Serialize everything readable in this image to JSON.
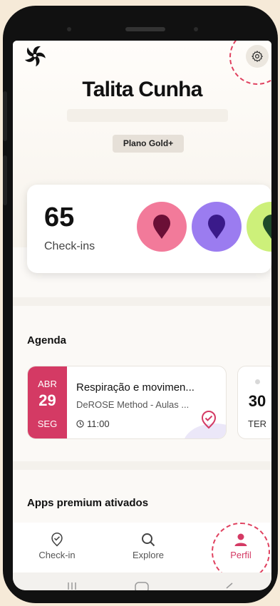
{
  "profile": {
    "name": "Talita Cunha",
    "plan": "Plano Gold+"
  },
  "checkins": {
    "count": "65",
    "label": "Check-ins",
    "badges": [
      {
        "icon": "pin-icon",
        "bg": "#f27a9a",
        "fg": "#6b0f36"
      },
      {
        "icon": "pin-icon",
        "bg": "#9b7cf0",
        "fg": "#3a1a8a"
      },
      {
        "icon": "pin-icon",
        "bg": "#cdf07a",
        "fg": "#1f4a2a"
      }
    ]
  },
  "agenda": {
    "title": "Agenda",
    "events": [
      {
        "month": "ABR",
        "day": "29",
        "weekday": "SEG",
        "title": "Respiração  e movimen...",
        "subtitle": "DeROSE Method - Aulas ...",
        "time": "11:00"
      },
      {
        "day": "30",
        "weekday": "TER"
      }
    ]
  },
  "premium": {
    "title": "Apps premium ativados"
  },
  "nav": {
    "items": [
      {
        "label": "Check-in",
        "icon": "checkin-icon"
      },
      {
        "label": "Explore",
        "icon": "search-icon"
      },
      {
        "label": "Perfil",
        "icon": "user-icon"
      }
    ],
    "active": "Perfil"
  },
  "colors": {
    "accent": "#d43a64",
    "highlight": "#e0415f"
  }
}
